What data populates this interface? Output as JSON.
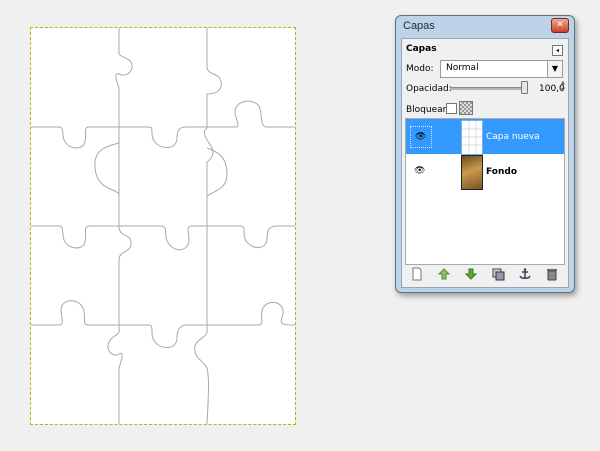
{
  "window": {
    "title": "Capas",
    "close_glyph": "✕"
  },
  "panel": {
    "heading": "Capas",
    "menu_icon": "panel-menu-icon",
    "mode": {
      "label": "Modo:",
      "value": "Normal"
    },
    "opacity": {
      "label": "Opacidad:",
      "value": "100,0",
      "level": 1.0
    },
    "lock": {
      "label": "Bloquear:"
    }
  },
  "layers": [
    {
      "name": "Capa nueva",
      "selected": true,
      "visible": true
    },
    {
      "name": "Fondo",
      "selected": false,
      "visible": true
    }
  ],
  "toolbar": {
    "new_icon": "new-layer-icon",
    "raise_icon": "raise-layer-icon",
    "lower_icon": "lower-layer-icon",
    "duplicate_icon": "duplicate-layer-icon",
    "anchor_icon": "anchor-layer-icon",
    "delete_icon": "delete-layer-icon"
  },
  "colors": {
    "selection": "#3399ff",
    "accent_green": "#5aa832",
    "marching_ants": "#c8b400"
  }
}
